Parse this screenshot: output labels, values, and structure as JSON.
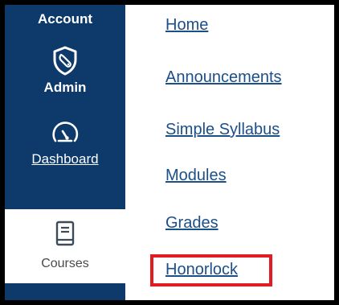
{
  "global_nav": {
    "account": {
      "label": "Account"
    },
    "admin": {
      "label": "Admin",
      "icon": "shield-wrench-icon"
    },
    "dashboard": {
      "label": "Dashboard",
      "icon": "speedometer-icon"
    },
    "courses": {
      "label": "Courses",
      "icon": "book-icon"
    }
  },
  "course_nav": {
    "links": [
      {
        "label": "Home"
      },
      {
        "label": "Announcements"
      },
      {
        "label": "Simple Syllabus"
      },
      {
        "label": "Modules"
      },
      {
        "label": "Grades"
      },
      {
        "label": "Honorlock"
      }
    ],
    "highlighted": "Honorlock"
  },
  "colors": {
    "nav_background": "#0d3a6b",
    "link": "#1b4f8a",
    "highlight_border": "#e31b23",
    "frame_border": "#000000"
  }
}
